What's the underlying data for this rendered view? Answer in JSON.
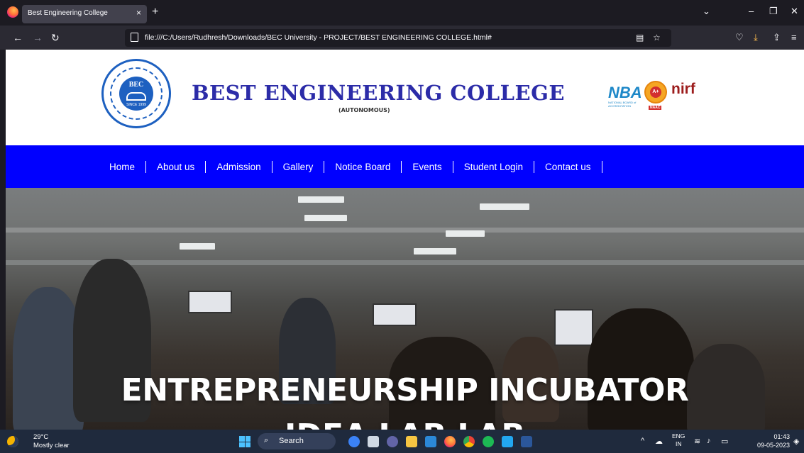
{
  "browser": {
    "tab_title": "Best Engineering College",
    "tab_close": "×",
    "new_tab": "+",
    "url": "file:///C:/Users/Rudhresh/Downloads/BEC University - PROJECT/BEST ENGINEERING COLLEGE.html#"
  },
  "header": {
    "seal_text": "BEC",
    "seal_since": "SINCE 1999",
    "title": "BEST ENGINEERING COLLEGE",
    "subtitle": "(AUTONOMOUS)",
    "nba": "NBA",
    "nba_sub": "NATIONAL BOARD of ACCREDITATION",
    "naac_grade": "A+",
    "naac": "NAAC",
    "nirf": "nirf"
  },
  "menu": {
    "items": [
      "Home",
      "About us",
      "Admission",
      "Gallery",
      "Notice Board",
      "Events",
      "Student Login",
      "Contact us"
    ]
  },
  "hero": {
    "title": "ENTREPRENEURSHIP INCUBATOR",
    "title2": "IDEA LAB LAB"
  },
  "taskbar": {
    "temperature": "29°C",
    "weather": "Mostly clear",
    "search": "Search",
    "lang_top": "ENG",
    "lang_bottom": "IN",
    "time": "01:43",
    "date": "09-05-2023"
  }
}
